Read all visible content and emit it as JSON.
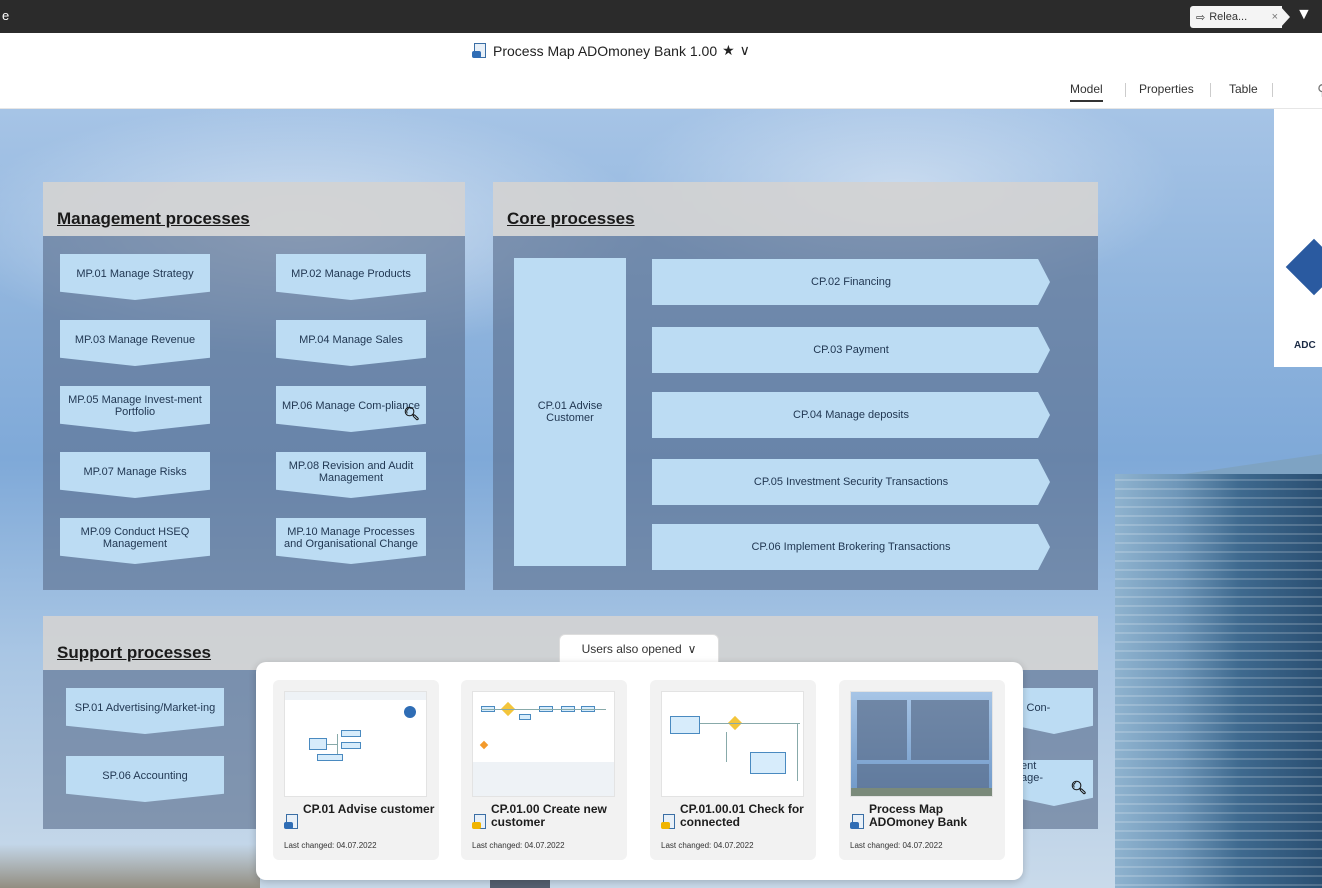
{
  "topbar": {
    "edge_letter": "e",
    "release_tab_label": "Relea...",
    "release_tab_close": "×"
  },
  "titlebar": {
    "title": "Process Map ADOmoney Bank 1.00",
    "star": "★",
    "chevron": "∨"
  },
  "view_tabs": [
    {
      "label": "Model",
      "active": true
    },
    {
      "label": "Properties",
      "active": false
    },
    {
      "label": "Table",
      "active": false
    }
  ],
  "logo_text": "ADC",
  "management": {
    "title": "Management processes",
    "items": [
      "MP.01 Manage Strategy",
      "MP.02 Manage Products",
      "MP.03 Manage Revenue",
      "MP.04 Manage Sales",
      "MP.05 Manage Invest-ment Portfolio",
      "MP.06 Manage Com-pliance",
      "MP.07 Manage Risks",
      "MP.08 Revision and Audit Management",
      "MP.09 Conduct HSEQ Management",
      "MP.10 Manage Processes and Organisational Change"
    ]
  },
  "core": {
    "title": "Core processes",
    "left": "CP.01 Advise Customer",
    "items": [
      "CP.02 Financing",
      "CP.03 Payment",
      "CP.04 Manage deposits",
      "CP.05 Investment Security Transactions",
      "CP.06 Implement Brokering Transactions"
    ]
  },
  "support": {
    "title": "Support processes",
    "items": [
      "SP.01 Advertising/Market-ing",
      "SP.06 Accounting"
    ],
    "partial_right_1": "l Con-",
    "partial_right_2_line1": "ent",
    "partial_right_2_line2": "age-"
  },
  "users_also_opened": {
    "button_label": "Users also opened",
    "cards": [
      {
        "title": "CP.01 Advise customer",
        "date": "Last changed: 04.07.2022",
        "icon": "blue"
      },
      {
        "title": "CP.01.00 Create new customer",
        "date": "Last changed: 04.07.2022",
        "icon": "yellow"
      },
      {
        "title": "CP.01.00.01 Check for connected",
        "date": "Last changed: 04.07.2022",
        "icon": "yellow"
      },
      {
        "title": "Process Map ADOmoney Bank",
        "date": "Last changed: 04.07.2022",
        "icon": "blue"
      }
    ]
  }
}
